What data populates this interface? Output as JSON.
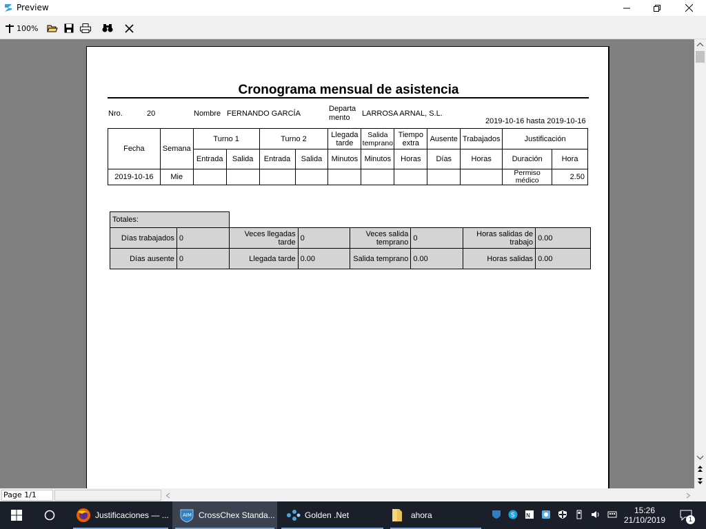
{
  "window": {
    "title": "Preview"
  },
  "toolbar": {
    "zoom": "100%"
  },
  "report": {
    "title": "Cronograma mensual de asistencia",
    "nro_label": "Nro.",
    "nro_value": "20",
    "nombre_label": "Nombre",
    "nombre_value": "FERNANDO GARCÍA",
    "depto_label_1": "Departa",
    "depto_label_2": "mento",
    "depto_value": "LARROSA ARNAL, S.L.",
    "range": "2019-10-16 hasta 2019-10-16",
    "headers": {
      "fecha": "Fecha",
      "semana": "Semana",
      "turno1": "Turno 1",
      "turno2": "Turno 2",
      "llegada": "Llegada tarde",
      "salida_temp": "Salida temprano",
      "tiempo_extra": "Tiempo extra",
      "ausente": "Ausente",
      "trabajados": "Trabajados",
      "justificacion": "Justificación",
      "entrada1": "Entrada",
      "salida1": "Salida",
      "entrada2": "Entrada",
      "salida2": "Salida",
      "minutos1": "Minutos",
      "minutos2": "Minutos",
      "horas1": "Horas",
      "dias": "Días",
      "horas2": "Horas",
      "duracion": "Duración",
      "hora": "Hora"
    },
    "row": {
      "fecha": "2019-10-16",
      "semana": "Mie",
      "duracion": "Permiso médico",
      "hora": "2.50"
    },
    "totals": {
      "label": "Totales:",
      "dias_trabajados_label": "Días trabajados",
      "dias_trabajados": "0",
      "veces_llegadas_label": "Veces llegadas tarde",
      "veces_llegadas": "0",
      "veces_salida_label": "Veces salida temprano",
      "veces_salida": "0",
      "horas_salidas_trabajo_label": "Horas salidas de trabajo",
      "horas_salidas_trabajo": "0.00",
      "dias_ausente_label": "Días ausente",
      "dias_ausente": "0",
      "llegada_tarde_label": "Llegada tarde",
      "llegada_tarde": "0.00",
      "salida_temprano_label": "Salida temprano",
      "salida_temprano": "0.00",
      "horas_salidas_label": "Horas salidas",
      "horas_salidas": "0.00"
    }
  },
  "status": {
    "page": "Page 1/1"
  },
  "taskbar": {
    "items": [
      "Justificaciones — ...",
      "CrossChex Standa...",
      "Golden .Net",
      "ahora"
    ],
    "time": "15:26",
    "date": "21/10/2019",
    "notif_count": "1"
  }
}
